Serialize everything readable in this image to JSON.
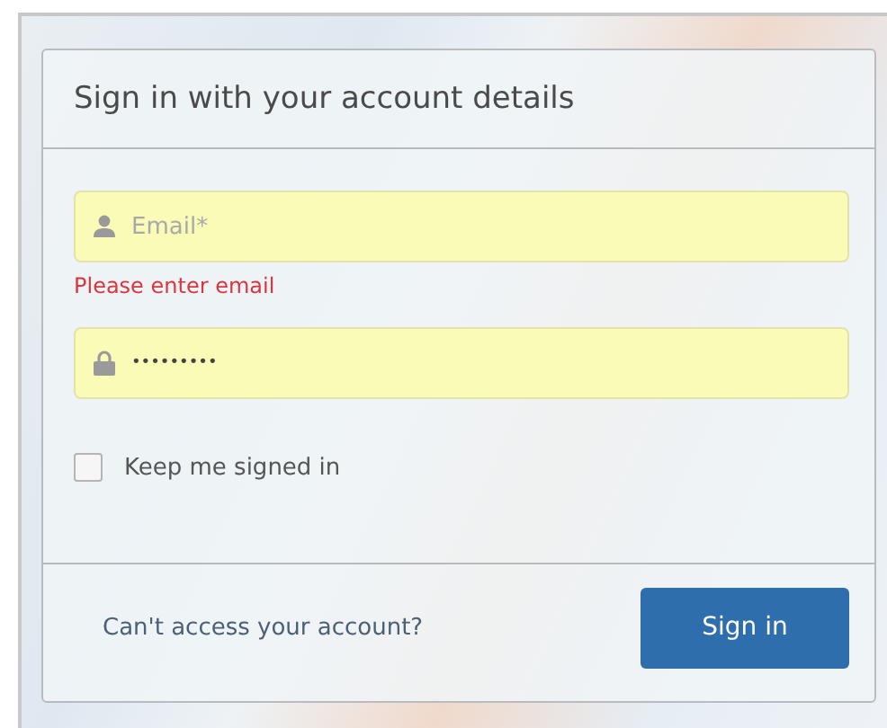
{
  "panel": {
    "title": "Sign in with your account details"
  },
  "email": {
    "placeholder": "Email*",
    "error": "Please enter email"
  },
  "password": {
    "value": "•••••••••"
  },
  "remember": {
    "label": "Keep me signed in",
    "checked": false
  },
  "footer": {
    "link": "Can't access your account?",
    "button": "Sign in"
  }
}
